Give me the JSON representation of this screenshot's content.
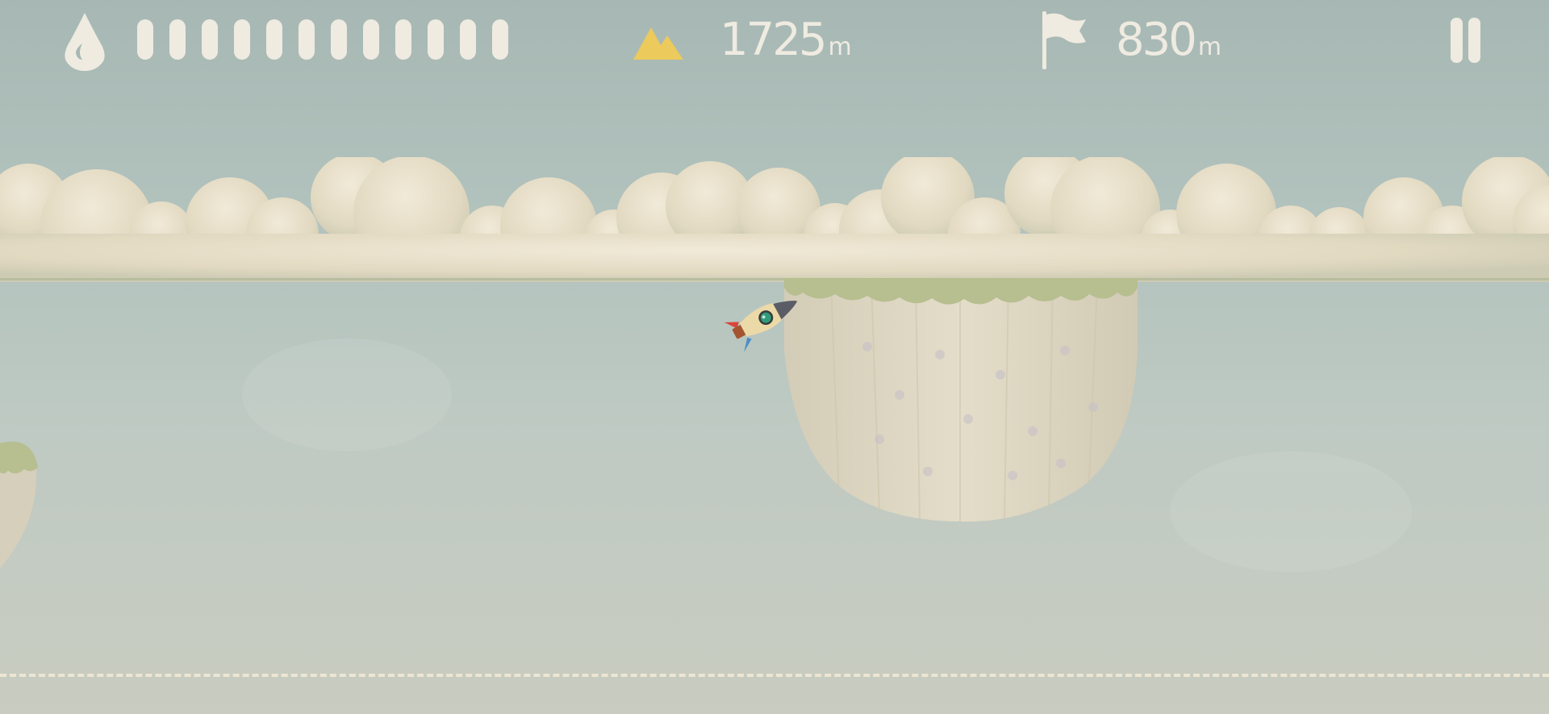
{
  "hud": {
    "fuel": {
      "icon": "water-drop-icon",
      "total_segments": 12,
      "filled_segments": 12
    },
    "altitude": {
      "icon": "mountain-icon",
      "value": "1725",
      "unit": "m"
    },
    "distance": {
      "icon": "flag-icon",
      "value": "830",
      "unit": "m"
    },
    "pause": {
      "icon": "pause-icon"
    }
  },
  "scene": {
    "player": "rocket",
    "objects": [
      "cloud-layer",
      "floating-island",
      "floating-island-partial",
      "dashed-ground-line"
    ]
  },
  "colors": {
    "hud_text": "#efebe1",
    "mountain": "#ecca5c",
    "sky_top": "#a7b8b4",
    "sky_bottom": "#c9ccc0",
    "cloud": "#ebe3cf",
    "island_grass": "#b7be8f",
    "island_body": "#ddd6c2"
  }
}
